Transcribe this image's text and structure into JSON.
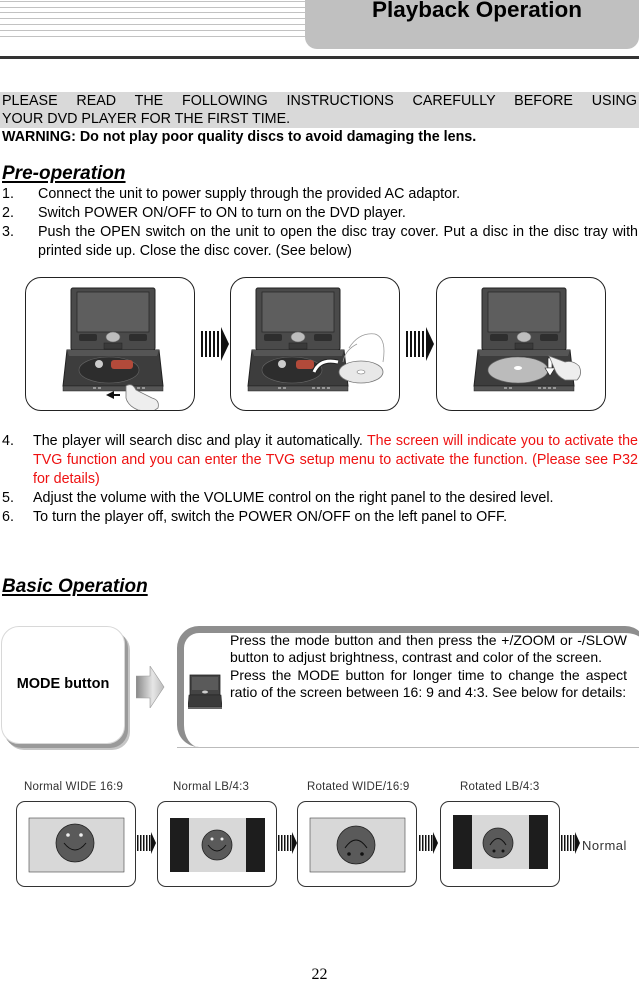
{
  "header": {
    "title": "Playback Operation"
  },
  "notice": {
    "line1": "PLEASE READ THE FOLLOWING INSTRUCTIONS CAREFULLY BEFORE USING",
    "line2": "YOUR DVD PLAYER FOR THE FIRST TIME.",
    "warning": "WARNING: Do not play poor quality discs to avoid damaging the lens."
  },
  "pre_operation": {
    "title": "Pre-operation",
    "steps": [
      {
        "num": "1.",
        "text": "Connect the unit to power supply through the provided AC adaptor."
      },
      {
        "num": "2.",
        "text": "Switch POWER ON/OFF to ON to turn on the DVD player."
      },
      {
        "num": "3.",
        "text": "Push the OPEN switch on the unit to open the disc tray cover. Put a disc in the disc tray with printed side up. Close the disc cover. (See below)"
      }
    ],
    "illustrations": [
      {
        "icon": "dvd-player-open-switch-icon"
      },
      {
        "icon": "dvd-player-insert-disc-icon"
      },
      {
        "icon": "dvd-player-close-cover-icon"
      }
    ],
    "steps_after": [
      {
        "num": "4.",
        "text": "The player will search disc and play it automatically. ",
        "highlight": "The screen will indicate you to activate the TVG function and you can enter the TVG setup menu to activate the function. (Please see P32 for details)",
        "highlight_color": "#ee1111"
      },
      {
        "num": "5.",
        "text": "Adjust the volume with the VOLUME control on the right panel to the desired level."
      },
      {
        "num": "6.",
        "text": "To turn the player off, switch the POWER ON/OFF on the left panel to OFF."
      }
    ]
  },
  "basic_operation": {
    "title": "Basic Operation",
    "mode_button_label": "MODE button",
    "description": [
      "Press the mode button and then press the +/ZOOM or -/SLOW button to adjust brightness, contrast and color of the screen.",
      "Press the MODE button for longer time to change the aspect ratio of the screen between 16: 9 and 4:3. See below for details:"
    ],
    "aspect_modes": [
      {
        "label": "Normal WIDE 16:9",
        "icon": "smiley-wide-icon"
      },
      {
        "label": "Normal LB/4:3",
        "icon": "smiley-letterbox-icon"
      },
      {
        "label": "Rotated WIDE/16:9",
        "icon": "smiley-rotated-wide-icon"
      },
      {
        "label": "Rotated LB/4:3",
        "icon": "smiley-rotated-letterbox-icon"
      }
    ],
    "cycle_end_label": "Normal"
  },
  "page_number": "22"
}
